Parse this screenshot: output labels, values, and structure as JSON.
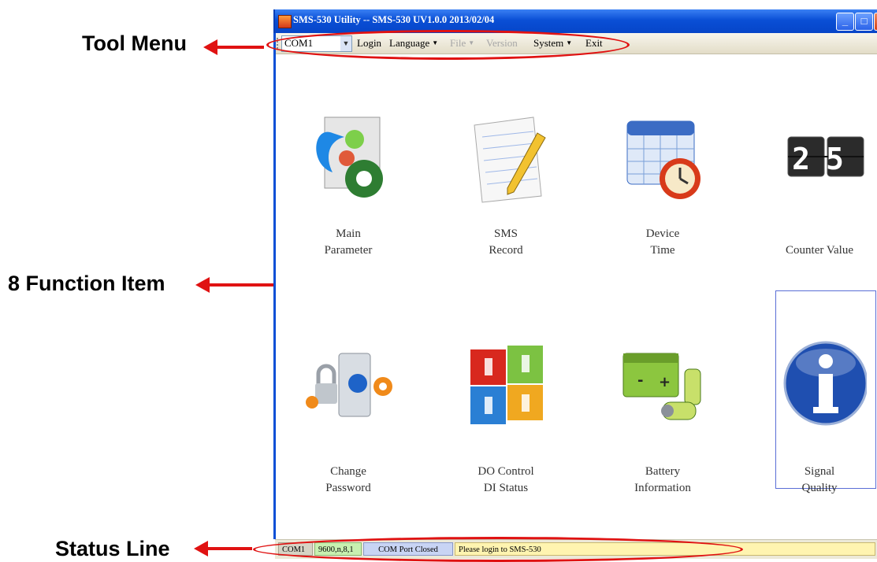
{
  "annotations": {
    "tool_menu": "Tool Menu",
    "function_items": "8 Function Item",
    "status_line": "Status Line"
  },
  "window": {
    "title": "SMS-530 Utility -- SMS-530 UV1.0.0 2013/02/04"
  },
  "menubar": {
    "port_value": "COM1",
    "items": [
      {
        "label": "Login",
        "enabled": true,
        "dropdown": false
      },
      {
        "label": "Language",
        "enabled": true,
        "dropdown": true
      },
      {
        "label": "File",
        "enabled": false,
        "dropdown": true
      },
      {
        "label": "Version",
        "enabled": false,
        "dropdown": false
      },
      {
        "label": "System",
        "enabled": true,
        "dropdown": true
      },
      {
        "label": "Exit",
        "enabled": true,
        "dropdown": false
      }
    ]
  },
  "functions": [
    {
      "label": "Main\nParameter",
      "icon": "settings-gear-icon"
    },
    {
      "label": "SMS\nRecord",
      "icon": "notepad-pencil-icon"
    },
    {
      "label": "Device\nTime",
      "icon": "calendar-clock-icon"
    },
    {
      "label": "Counter Value",
      "icon": "counter-display-icon",
      "counter_digits": "25"
    },
    {
      "label": "Change\nPassword",
      "icon": "lock-key-icon"
    },
    {
      "label": "DO Control\nDI Status",
      "icon": "switch-panel-icon"
    },
    {
      "label": "Battery\nInformation",
      "icon": "battery-icon"
    },
    {
      "label": "Signal\nQuality",
      "icon": "info-icon",
      "selected": true
    }
  ],
  "statusbar": {
    "port": "COM1",
    "settings": "9600,n,8,1",
    "port_state": "COM Port Closed",
    "message": "Please login to SMS-530"
  },
  "colors": {
    "annotation_red": "#e01212",
    "title_blue": "#0a4fd6",
    "status_green": "#c8f0b0",
    "status_blue": "#c8d4f4",
    "status_yellow": "#fff4b0"
  }
}
